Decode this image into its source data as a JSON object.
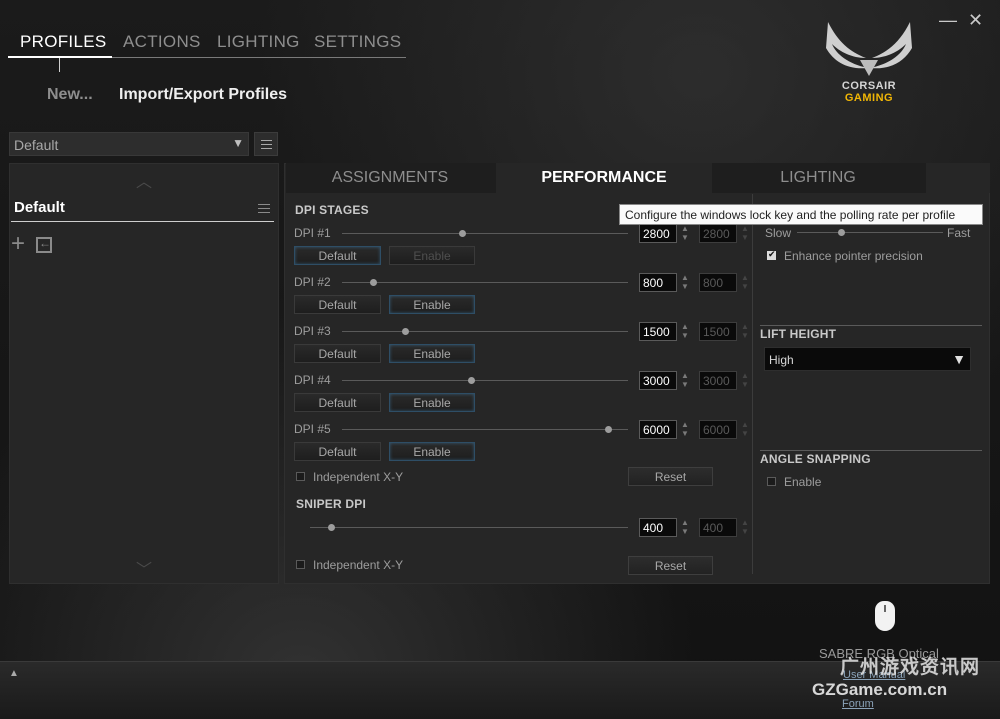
{
  "nav": {
    "tabs": [
      "PROFILES",
      "ACTIONS",
      "LIGHTING",
      "SETTINGS"
    ],
    "active_tab": "PROFILES",
    "sub_new": "New...",
    "sub_import_export": "Import/Export Profiles"
  },
  "window": {
    "minimize": "—",
    "close": "✕"
  },
  "logo": {
    "line1": "CORSAIR",
    "line2": "GAMING"
  },
  "profiles": {
    "selected": "Default",
    "items": [
      "Default"
    ]
  },
  "tabs": {
    "assignments": "ASSIGNMENTS",
    "performance": "PERFORMANCE",
    "lighting": "LIGHTING",
    "active": "PERFORMANCE"
  },
  "dpi": {
    "section_title": "DPI STAGES",
    "default_label": "Default",
    "enable_label": "Enable",
    "stages": [
      {
        "label": "DPI #1",
        "value": "2800",
        "secondary": "2800",
        "slider_pct": 0.42
      },
      {
        "label": "DPI #2",
        "value": "800",
        "secondary": "800",
        "slider_pct": 0.11
      },
      {
        "label": "DPI #3",
        "value": "1500",
        "secondary": "1500",
        "slider_pct": 0.22
      },
      {
        "label": "DPI #4",
        "value": "3000",
        "secondary": "3000",
        "slider_pct": 0.45
      },
      {
        "label": "DPI #5",
        "value": "6000",
        "secondary": "6000",
        "slider_pct": 0.93
      }
    ],
    "independent_xy": "Independent X-Y",
    "reset": "Reset"
  },
  "sniper": {
    "section_title": "SNIPER DPI",
    "value": "400",
    "secondary": "400",
    "slider_pct": 0.02,
    "independent_xy": "Independent X-Y",
    "reset": "Reset"
  },
  "pointer": {
    "slow": "Slow",
    "fast": "Fast",
    "speed_pct": 0.3,
    "enhance_label": "Enhance pointer precision",
    "enhance_checked": true
  },
  "lift": {
    "title": "LIFT HEIGHT",
    "value": "High"
  },
  "angle": {
    "title": "ANGLE SNAPPING",
    "enable_label": "Enable",
    "checked": false
  },
  "tooltip": "Configure the windows lock key and the polling rate per profile",
  "device": {
    "name": "SABRE RGB Optical",
    "user_manual": "User Manual",
    "forum": "Forum"
  },
  "watermark": {
    "cn": "广州游戏资讯网",
    "en": "GZGame.com.cn"
  },
  "colors": {
    "accent_gold": "#f2b705",
    "button_glow": "#2e4e66"
  }
}
